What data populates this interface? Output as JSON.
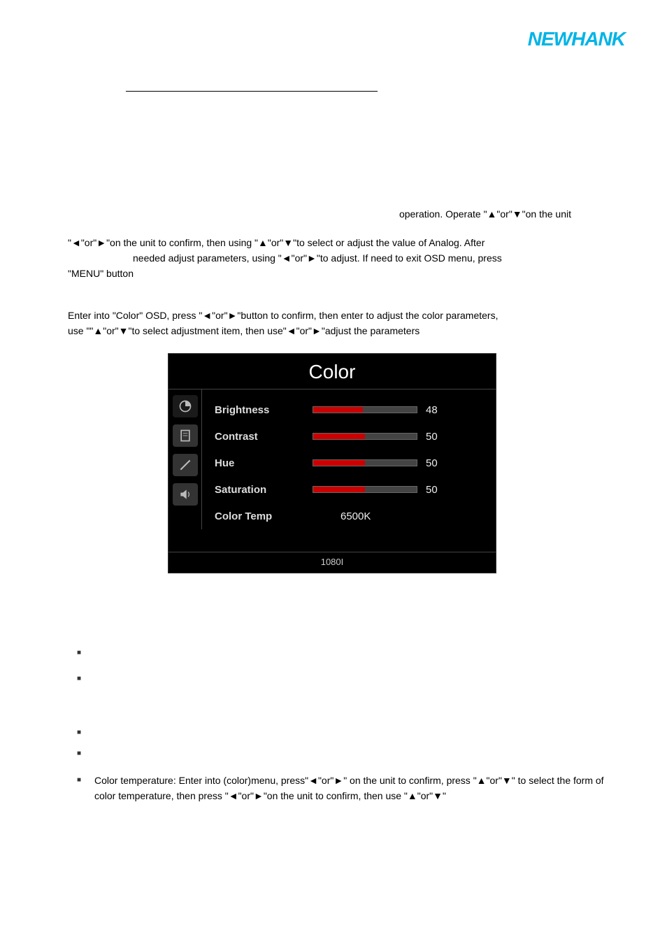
{
  "logo": {
    "brand": "NEWHANK"
  },
  "paragraphs": {
    "p1": "operation. Operate \"▲\"or\"▼\"on the unit",
    "p2": "\"◄\"or\"►\"on the unit to confirm, then using \"▲\"or\"▼\"to select or adjust the value of Analog. After",
    "p3": "needed adjust parameters, using \"◄\"or\"►\"to adjust. If need to exit OSD menu, press",
    "p4": "\"MENU\" button",
    "p5": "Enter into \"Color\" OSD, press \"◄\"or\"►\"button to confirm, then enter to adjust the color parameters,",
    "p6": "use \"\"▲\"or\"▼\"to select adjustment item, then use\"◄\"or\"►\"adjust the parameters"
  },
  "osd": {
    "title": "Color",
    "rows": [
      {
        "label": "Brightness",
        "value": 48,
        "fill": 48
      },
      {
        "label": "Contrast",
        "value": 50,
        "fill": 50
      },
      {
        "label": "Hue",
        "value": 50,
        "fill": 50
      },
      {
        "label": "Saturation",
        "value": 50,
        "fill": 50
      }
    ],
    "colorTempLabel": "Color Temp",
    "colorTempValue": "6500K",
    "footer": "1080I"
  },
  "bullets": {
    "b5": "Color temperature: Enter into (color)menu, press\"◄\"or\"►\" on the unit  to confirm, press \"▲\"or\"▼\" to select the form of color temperature, then press \"◄\"or\"►\"on the unit to confirm, then use \"▲\"or\"▼\""
  },
  "chart_data": {
    "type": "table",
    "title": "Color",
    "rows": [
      {
        "parameter": "Brightness",
        "value": 48
      },
      {
        "parameter": "Contrast",
        "value": 50
      },
      {
        "parameter": "Hue",
        "value": 50
      },
      {
        "parameter": "Saturation",
        "value": 50
      },
      {
        "parameter": "Color Temp",
        "value": "6500K"
      }
    ],
    "footer": "1080I"
  }
}
